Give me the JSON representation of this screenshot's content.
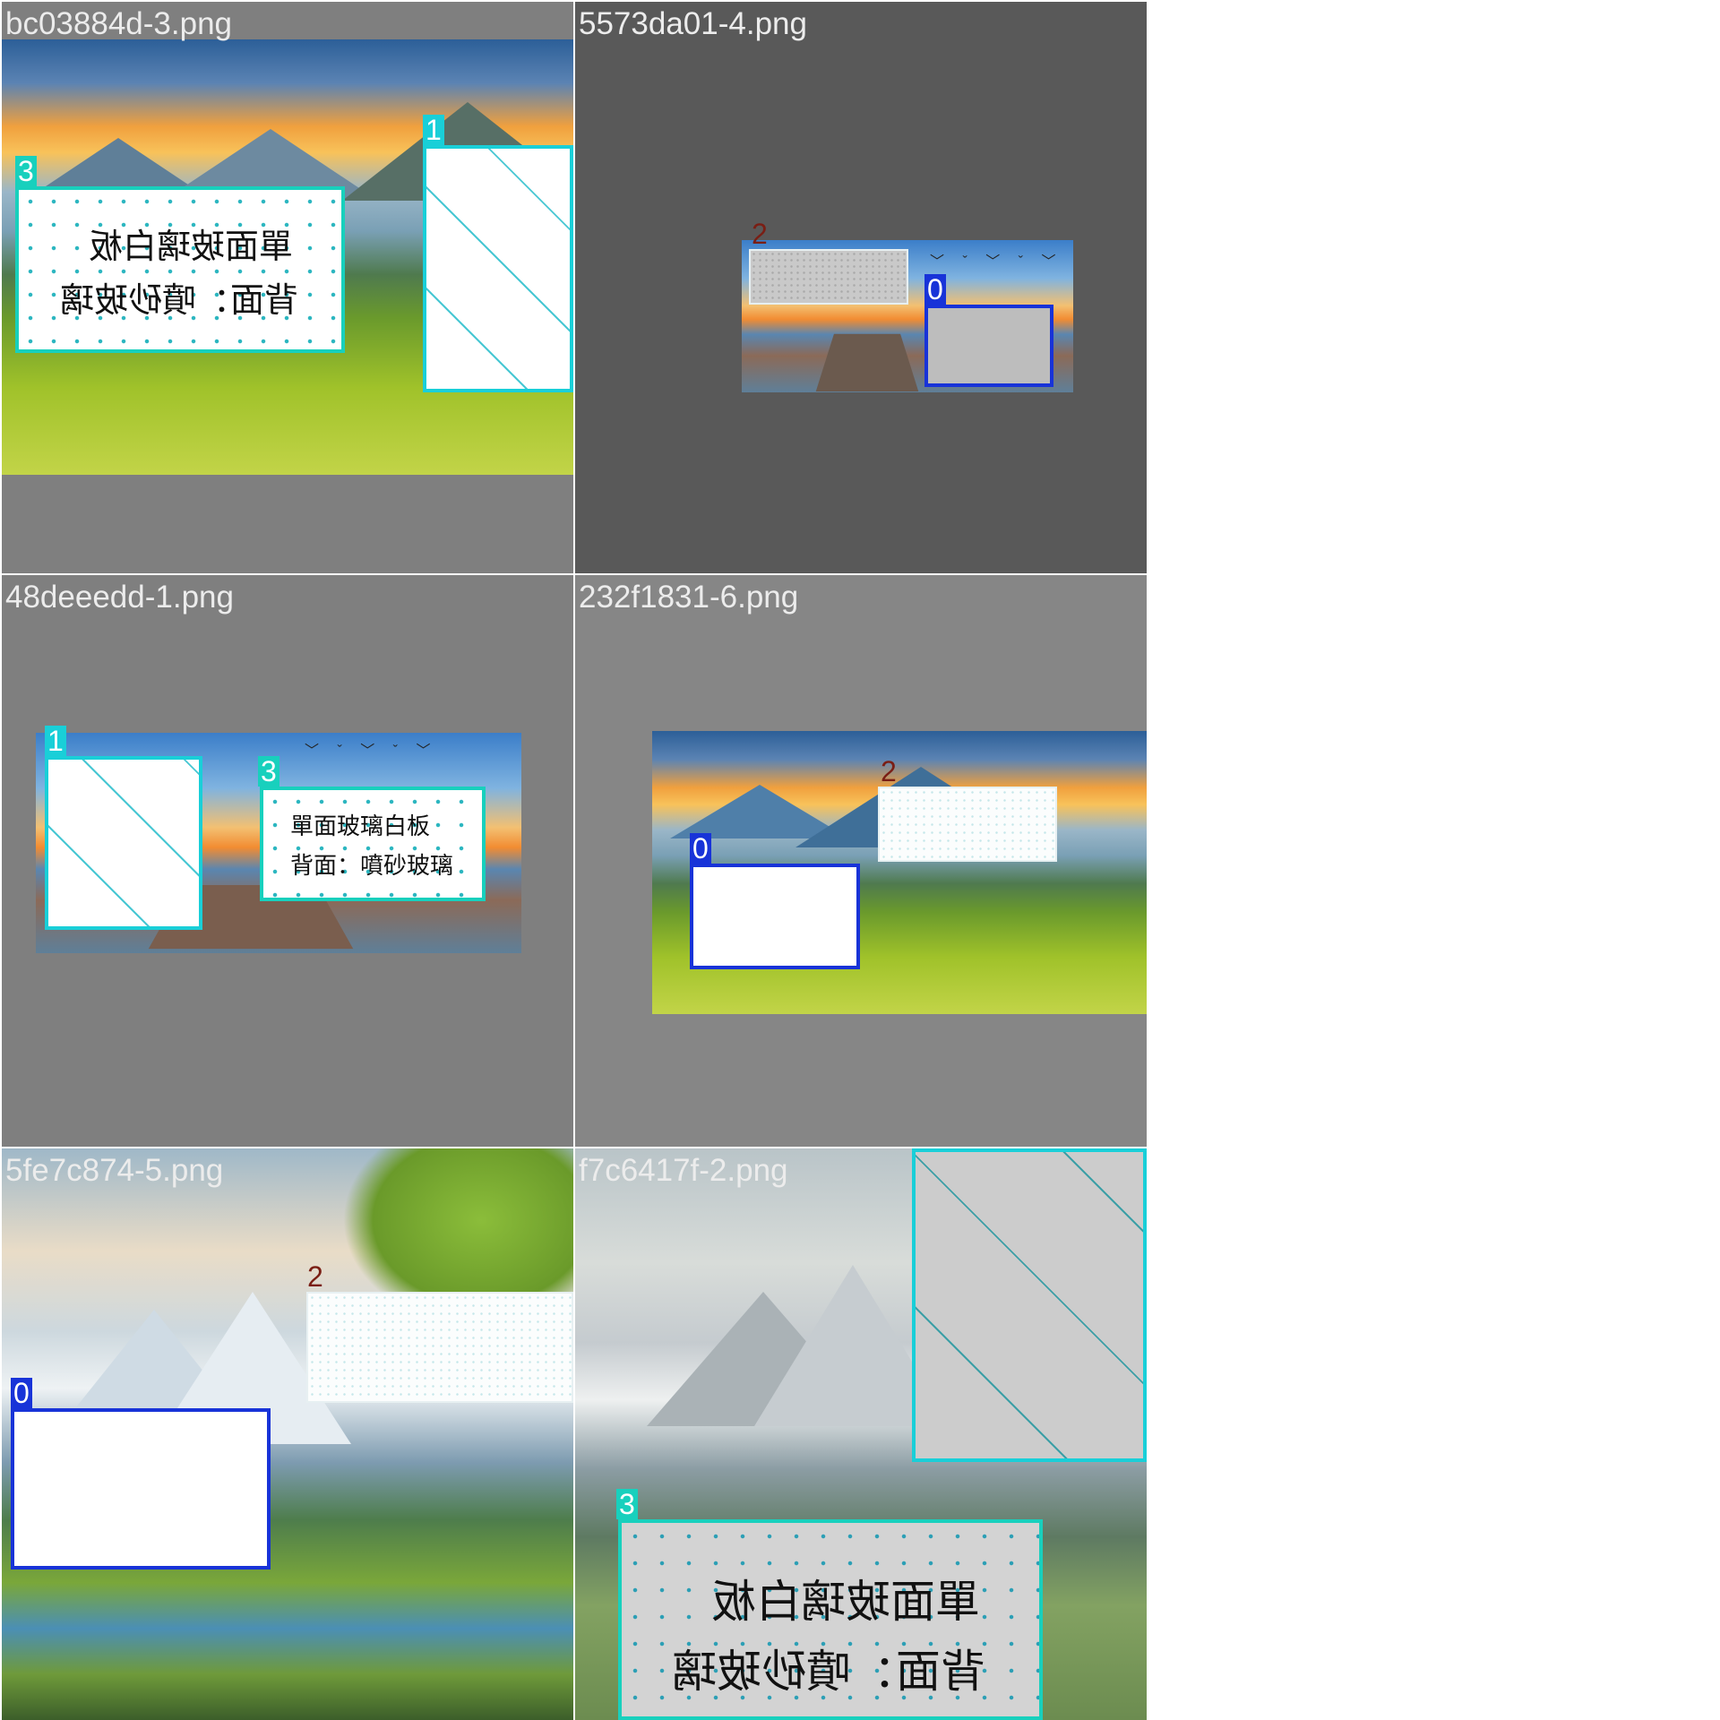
{
  "tiles": [
    {
      "filename": "bc03884d-3.png"
    },
    {
      "filename": "5573da01-4.png"
    },
    {
      "filename": "48deeedd-1.png"
    },
    {
      "filename": "232f1831-6.png"
    },
    {
      "filename": "5fe7c874-5.png"
    },
    {
      "filename": "f7c6417f-2.png"
    }
  ],
  "box_labels": {
    "l0": "0",
    "l1": "1",
    "l2": "2",
    "l3": "3"
  },
  "sign": {
    "line1": "單面玻璃白板",
    "line2": "背面：噴砂玻璃",
    "line1_mirrored": "單面玻璃白板",
    "line2_mirrored": "背面：噴砂玻璃"
  },
  "birds": "﹀ ˇ ﹀ ˇ ﹀",
  "colors": {
    "class0": "#1833d8",
    "class1": "#19cfd8",
    "class2": "#7a1e14",
    "class3": "#18d0bd",
    "tile_grey": "#7f7f7f",
    "tile_dark_grey": "#595959",
    "tile_mid_grey": "#868686"
  }
}
